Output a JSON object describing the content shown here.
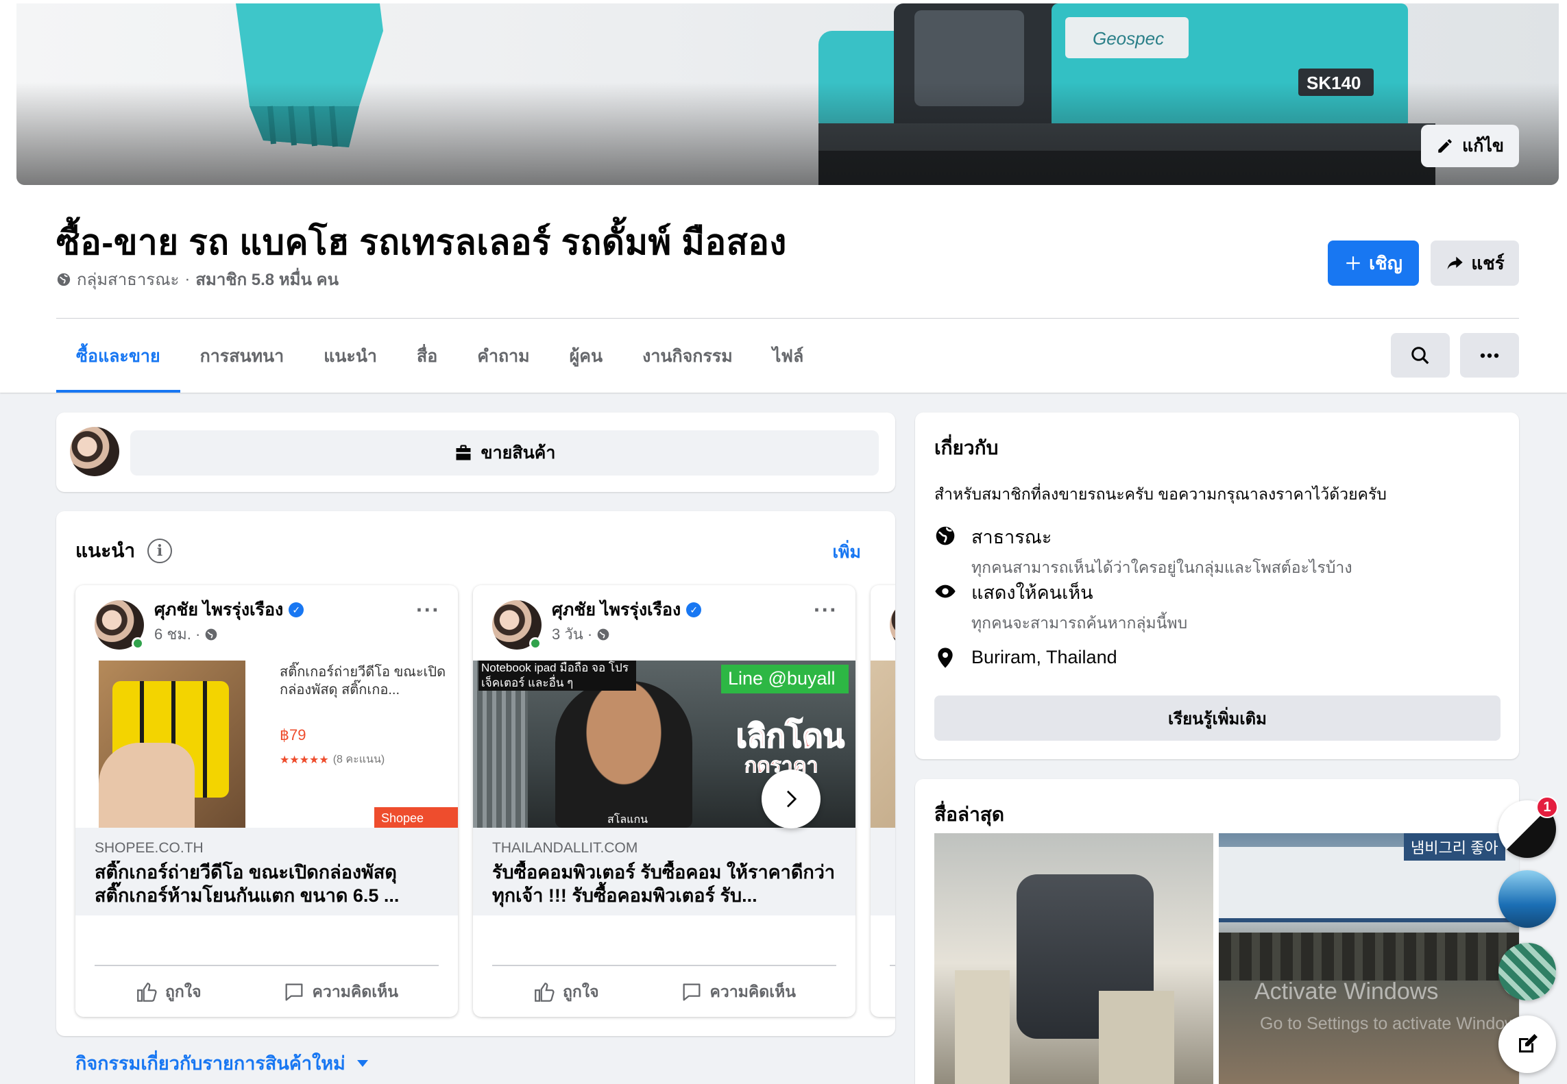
{
  "cover": {
    "edit_label": "แก้ไข",
    "machine_model": "SK140",
    "machine_brand": "Geospec"
  },
  "group": {
    "title": "ซื้อ-ขาย รถ แบคโฮ รถเทรลเลอร์ รถดั้มพ์ มือสอง",
    "privacy": "กลุ่มสาธารณะ",
    "members": "สมาชิก 5.8 หมื่น คน",
    "invite_label": "เชิญ",
    "share_label": "แชร์"
  },
  "tabs": [
    {
      "label": "ซื้อและขาย",
      "active": true
    },
    {
      "label": "การสนทนา",
      "active": false
    },
    {
      "label": "แนะนำ",
      "active": false
    },
    {
      "label": "สื่อ",
      "active": false
    },
    {
      "label": "คำถาม",
      "active": false
    },
    {
      "label": "ผู้คน",
      "active": false
    },
    {
      "label": "งานกิจกรรม",
      "active": false
    },
    {
      "label": "ไฟล์",
      "active": false
    }
  ],
  "sell": {
    "label": "ขายสินค้า"
  },
  "recommended": {
    "title": "แนะนำ",
    "more_label": "เพิ่ม",
    "posts": [
      {
        "author": "ศุภชัย ไพรรุ่งเรือง",
        "time": "6 ชม. ·",
        "domain": "SHOPEE.CO.TH",
        "link_title": "สติ๊กเกอร์ถ่ายวีดีโอ ขณะเปิดกล่องพัสดุ สติ๊กเกอร์ห้ามโยนกันแตก ขนาด 6.5 ...",
        "media_caption": "สติ๊กเกอร์ถ่ายวีดีโอ ขณะเปิดกล่องพัสดุ สติ๊กเกอ...",
        "media_price": "฿79",
        "media_rating": "★★★★★",
        "media_rating_count": "(8 คะแนน)",
        "media_badge": "Shopee",
        "like_label": "ถูกใจ",
        "comment_label": "ความคิดเห็น"
      },
      {
        "author": "ศุภชัย ไพรรุ่งเรือง",
        "time": "3 วัน ·",
        "domain": "THAILANDALLIT.COM",
        "link_title": "รับซื้อคอมพิวเตอร์ รับซื้อคอม ให้ราคาดีกว่าทุกเจ้า !!! รับซื้อคอมพิวเตอร์ รับ...",
        "media_top_text": "Notebook ipad มือถือ จอ โปรเจ็คเตอร์ และอื่น ๆ",
        "media_line": "Line @buyall",
        "media_big": "เลิกโดน",
        "media_small": "กดราคา",
        "media_slogan": "สโลแกน",
        "like_label": "ถูกใจ",
        "comment_label": "ความคิดเห็น"
      }
    ]
  },
  "activity_link": "กิจกรรมเกี่ยวกับรายการสินค้าใหม่",
  "about": {
    "title": "เกี่ยวกับ",
    "description": "สำหรับสมาชิกที่ลงขายรถนะครับ ขอความกรุณาลงราคาไว้ด้วยครับ",
    "public_title": "สาธารณะ",
    "public_desc": "ทุกคนสามารถเห็นได้ว่าใครอยู่ในกลุ่มและโพสต์อะไรบ้าง",
    "visible_title": "แสดงให้คนเห็น",
    "visible_desc": "ทุกคนจะสามารถค้นหากลุ่มนี้พบ",
    "location": "Buriram, Thailand",
    "learn_more": "เรียนรู้เพิ่มเติม"
  },
  "media": {
    "title": "สื่อล่าสุด",
    "sign_text": "냄비그리 좋아"
  },
  "chat": {
    "badge_count": "1"
  },
  "watermark": {
    "line1": "Activate Windows",
    "line2": "Go to Settings to activate Windows."
  },
  "colors": {
    "accent": "#1877f2",
    "bg": "#f0f2f5",
    "secondary_text": "#65676b",
    "online": "#31a24c",
    "badge": "#e41e3f"
  },
  "icons": [
    "pencil-icon",
    "globe-icon",
    "plus-icon",
    "share-arrow-icon",
    "search-icon",
    "more-dots-icon",
    "shop-bag-icon",
    "info-icon",
    "verified-icon",
    "like-icon",
    "comment-icon",
    "chevron-right-icon",
    "eye-icon",
    "location-pin-icon",
    "caret-down-icon",
    "compose-icon"
  ]
}
